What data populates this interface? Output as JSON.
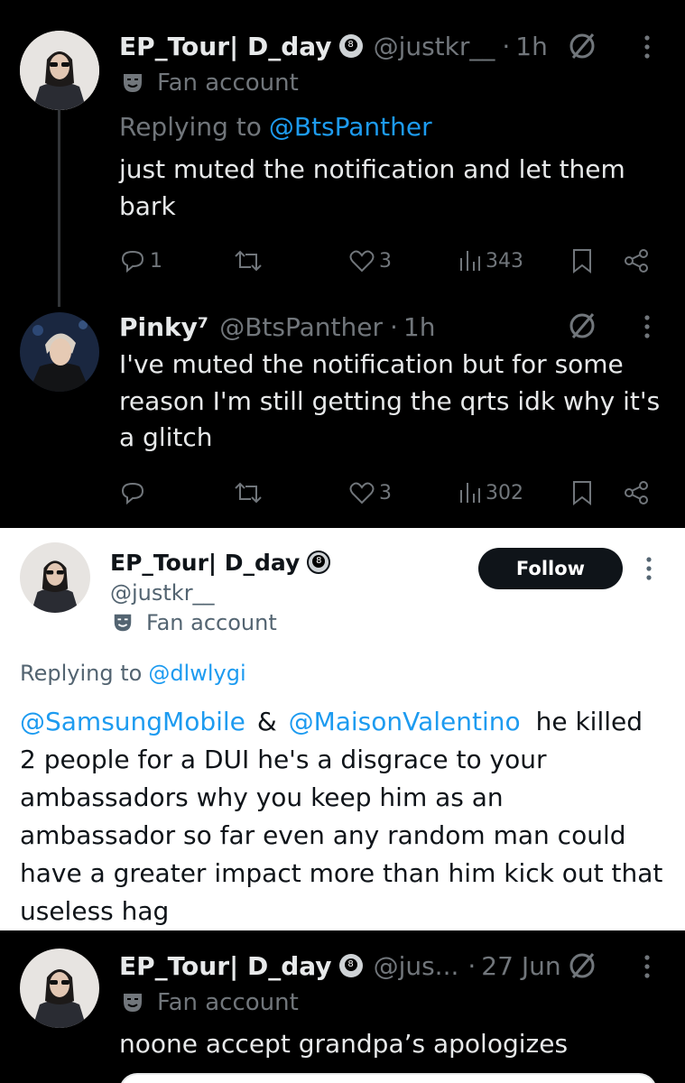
{
  "top_thread": {
    "tweet1": {
      "display_name": "EP_Tour| D_day",
      "handle": "@justkr__",
      "separator": "·",
      "time": "1h",
      "label": "Fan account",
      "replying_prefix": "Replying to",
      "replying_to": "@BtsPanther",
      "text": "just muted the notification and let them bark",
      "replies": "1",
      "likes": "3",
      "views": "343"
    },
    "tweet2": {
      "display_name": "Pinky⁷",
      "handle": "@BtsPanther",
      "separator": "·",
      "time": "1h",
      "text": "I've muted the notification but for some reason I'm still getting the qrts idk why it's a glitch",
      "likes": "3",
      "views": "302"
    }
  },
  "middle_tweet": {
    "display_name": "EP_Tour| D_day",
    "handle": "@justkr__",
    "label": "Fan account",
    "follow_label": "Follow",
    "replying_prefix": "Replying to",
    "replying_to": "@dlwlygi",
    "mention1": "@SamsungMobile",
    "ampersand": "&",
    "mention2": "@MaisonValentino",
    "text_line1_rest": "he",
    "text_rest": "killed 2 people for a DUI he's a disgrace to your ambassadors why you keep him as an ambassador so far even any random man could have a greater impact more than him kick out that useless hag"
  },
  "bottom_tweet": {
    "display_name": "EP_Tour| D_day",
    "handle": "@jus...",
    "separator": "·",
    "time": "27 Jun",
    "label": "Fan account",
    "text": "noone accept grandpa’s apologizes"
  },
  "badge_number": "8",
  "colors": {
    "dark_bg": "#000000",
    "light_bg": "#ffffff",
    "link_blue": "#1d9bf0",
    "muted_dark": "#71767b",
    "muted_light": "#536471"
  }
}
